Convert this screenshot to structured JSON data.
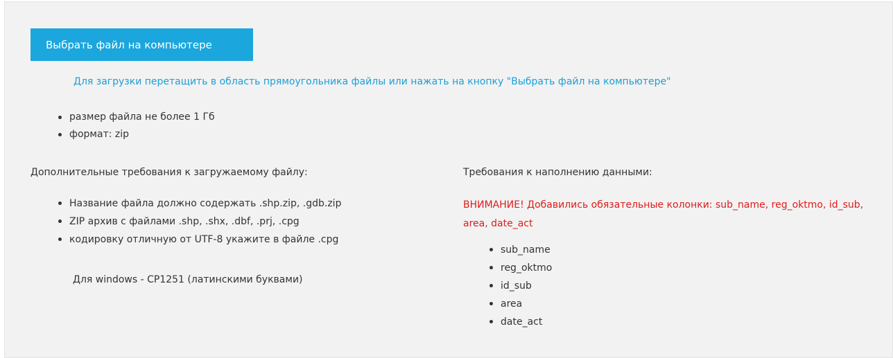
{
  "upload": {
    "button_label": "Выбрать файл на компьютере",
    "hint": "Для загрузки перетащить в область прямоугольника файлы или нажать на кнопку \"Выбрать файл на компьютере\""
  },
  "basic_requirements": [
    "размер файла не более 1 Гб",
    "формат: zip"
  ],
  "additional": {
    "title": "Дополнительные требования к загружаемому файлу:",
    "items": [
      "Название файла должно содержать .shp.zip, .gdb.zip",
      "ZIP архив с файлами .shp, .shx, .dbf, .prj, .cpg",
      "кодировку отличную от UTF-8 укажите в файле .cpg"
    ],
    "windows_note": "Для windows - CP1251 (латинскими буквами)"
  },
  "data_requirements": {
    "title": "Требования к наполнению данными:",
    "warning": "ВНИМАНИЕ! Добавились обязательные колонки: sub_name, reg_oktmo, id_sub, area, date_act",
    "columns": [
      "sub_name",
      "reg_oktmo",
      "id_sub",
      "area",
      "date_act"
    ]
  },
  "colors": {
    "button": "#1ba6dd",
    "hint": "#1b9fd8",
    "warning": "#e01b1b",
    "panel": "#f2f2f2"
  }
}
